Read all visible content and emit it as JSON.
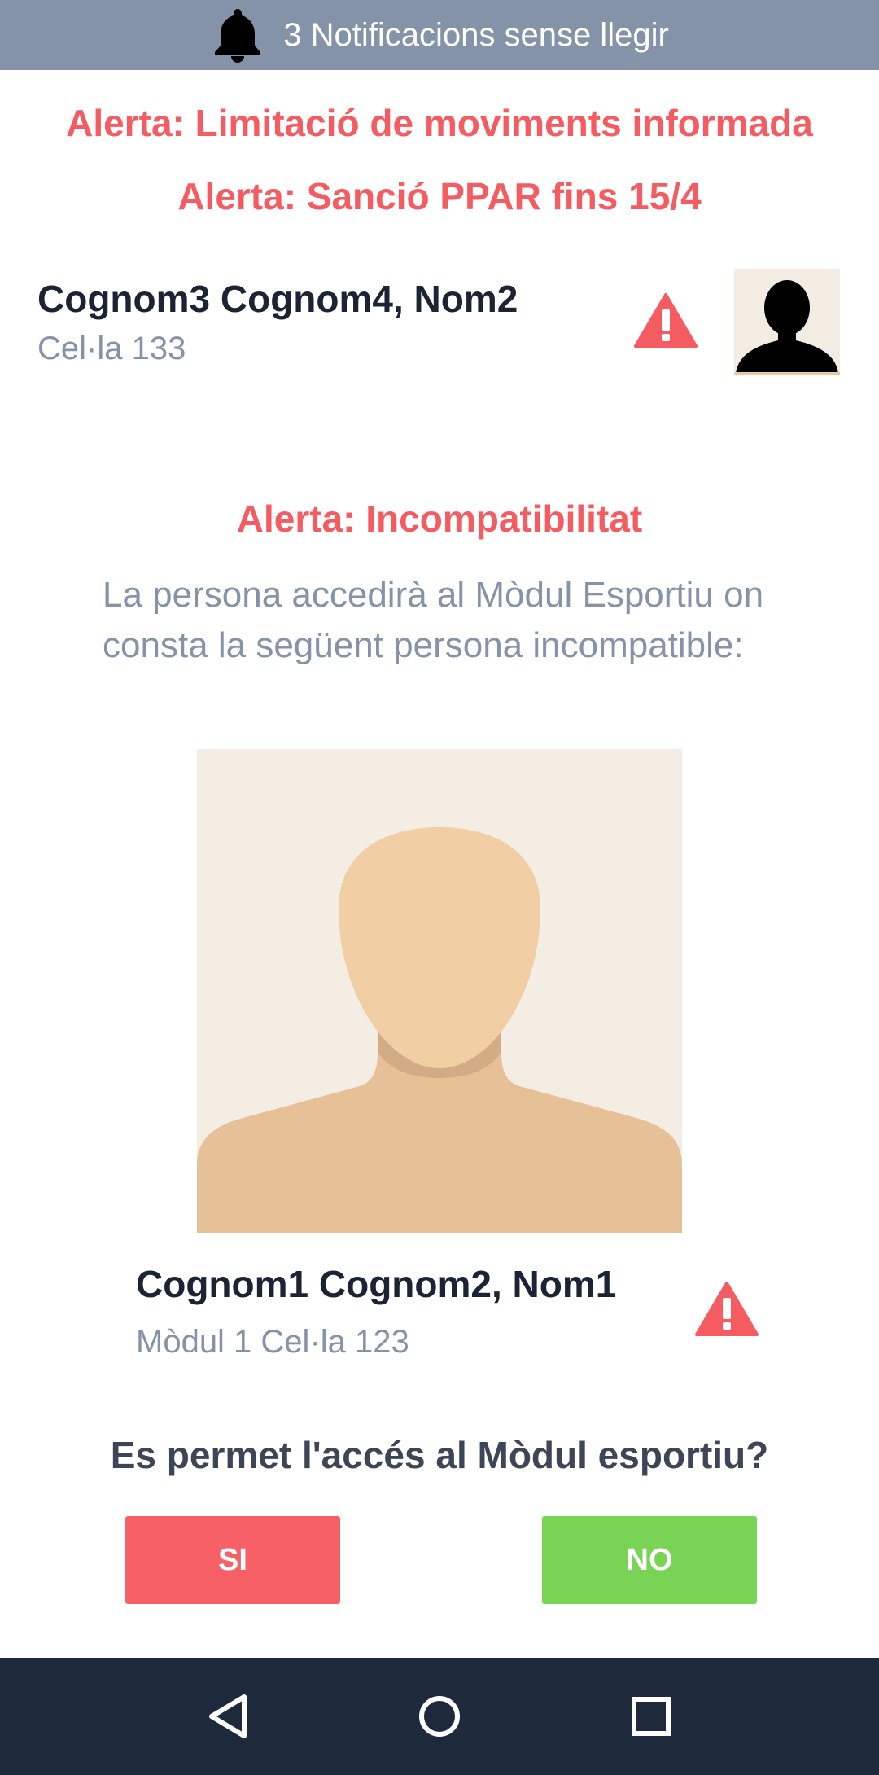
{
  "notifications": {
    "text": "3 Notificacions sense llegir",
    "icon": "bell-icon"
  },
  "alerts": {
    "movements": "Alerta: Limitació de moviments informada",
    "sanction": "Alerta: Sanció PPAR fins 15/4",
    "incompatibility": "Alerta: Incompatibilitat"
  },
  "current_person": {
    "name": "Cognom3 Cognom4, Nom2",
    "cell": "Cel·la 133",
    "warning_icon": "warning-icon"
  },
  "incompatibility": {
    "description": "La persona accedirà al Mòdul Esportiu on consta la següent persona incompatible:",
    "person": {
      "name": "Cognom1 Cognom2, Nom1",
      "location": "Mòdul 1 Cel·la 123"
    }
  },
  "question": "Es permet l'accés al Mòdul esportiu?",
  "buttons": {
    "yes": "SI",
    "no": "NO"
  },
  "colors": {
    "alert": "#f45c62",
    "notif_bar": "#8493a8",
    "yes_button": "#f86068",
    "no_button": "#79d354",
    "nav_bar": "#1e2a3c"
  },
  "nav": {
    "back_icon": "back-triangle-icon",
    "home_icon": "home-circle-icon",
    "recents_icon": "recents-square-icon"
  }
}
